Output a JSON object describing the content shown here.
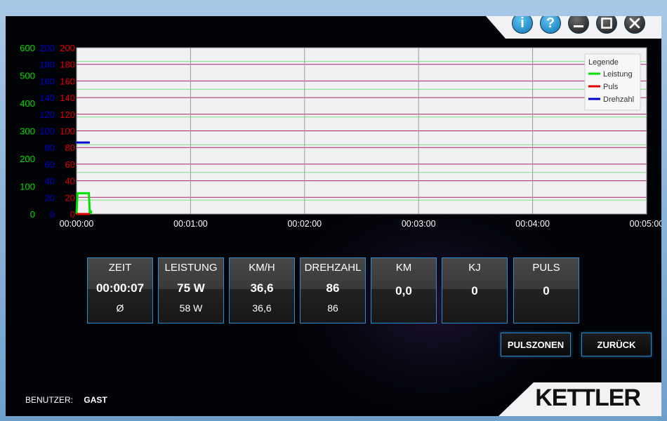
{
  "window_controls": {
    "info": "i",
    "help": "?"
  },
  "legend": {
    "title": "Legende",
    "items": [
      {
        "label": "Leistung",
        "color": "#00e000"
      },
      {
        "label": "Puls",
        "color": "#e00000"
      },
      {
        "label": "Drehzahl",
        "color": "#0000cc"
      }
    ]
  },
  "tiles": [
    {
      "label": "ZEIT",
      "value": "00:00:07",
      "avg": "Ø"
    },
    {
      "label": "LEISTUNG",
      "value": "75 W",
      "avg": "58 W"
    },
    {
      "label": "KM/H",
      "value": "36,6",
      "avg": "36,6"
    },
    {
      "label": "DREHZAHL",
      "value": "86",
      "avg": "86"
    },
    {
      "label": "KM",
      "value": "0,0",
      "avg": ""
    },
    {
      "label": "KJ",
      "value": "0",
      "avg": ""
    },
    {
      "label": "PULS",
      "value": "0",
      "avg": ""
    }
  ],
  "buttons": {
    "pulszonen": "PULSZONEN",
    "zurueck": "ZURÜCK"
  },
  "user": {
    "label": "BENUTZER:",
    "name": "GAST"
  },
  "brand": "KETTLER",
  "chart_data": {
    "type": "line",
    "x_ticks": [
      "00:00:00",
      "00:01:00",
      "00:02:00",
      "00:03:00",
      "00:04:00",
      "00:05:00"
    ],
    "xlim": [
      0,
      300
    ],
    "axes": [
      {
        "name": "Leistung",
        "color": "#00e000",
        "ylim": [
          0,
          600
        ],
        "ticks": [
          0,
          100,
          200,
          300,
          400,
          500,
          600
        ]
      },
      {
        "name": "Drehzahl",
        "color": "#0000cc",
        "ylim": [
          0,
          200
        ],
        "ticks": [
          0,
          20,
          40,
          60,
          80,
          100,
          120,
          140,
          160,
          180,
          200
        ]
      },
      {
        "name": "Puls",
        "color": "#e00000",
        "ylim": [
          0,
          200
        ],
        "ticks": [
          0,
          20,
          40,
          60,
          80,
          100,
          120,
          140,
          160,
          180,
          200
        ]
      }
    ],
    "series": [
      {
        "name": "Leistung",
        "axis": 0,
        "color": "#00e000",
        "points": [
          [
            0,
            0
          ],
          [
            0.5,
            75
          ],
          [
            6.5,
            75
          ],
          [
            7,
            0
          ]
        ]
      },
      {
        "name": "Puls",
        "axis": 2,
        "color": "#e00000",
        "points": [
          [
            0,
            0
          ],
          [
            7,
            0
          ]
        ]
      },
      {
        "name": "Drehzahl",
        "axis": 1,
        "color": "#0000cc",
        "points": [
          [
            0,
            86
          ],
          [
            7,
            86
          ]
        ]
      }
    ]
  }
}
